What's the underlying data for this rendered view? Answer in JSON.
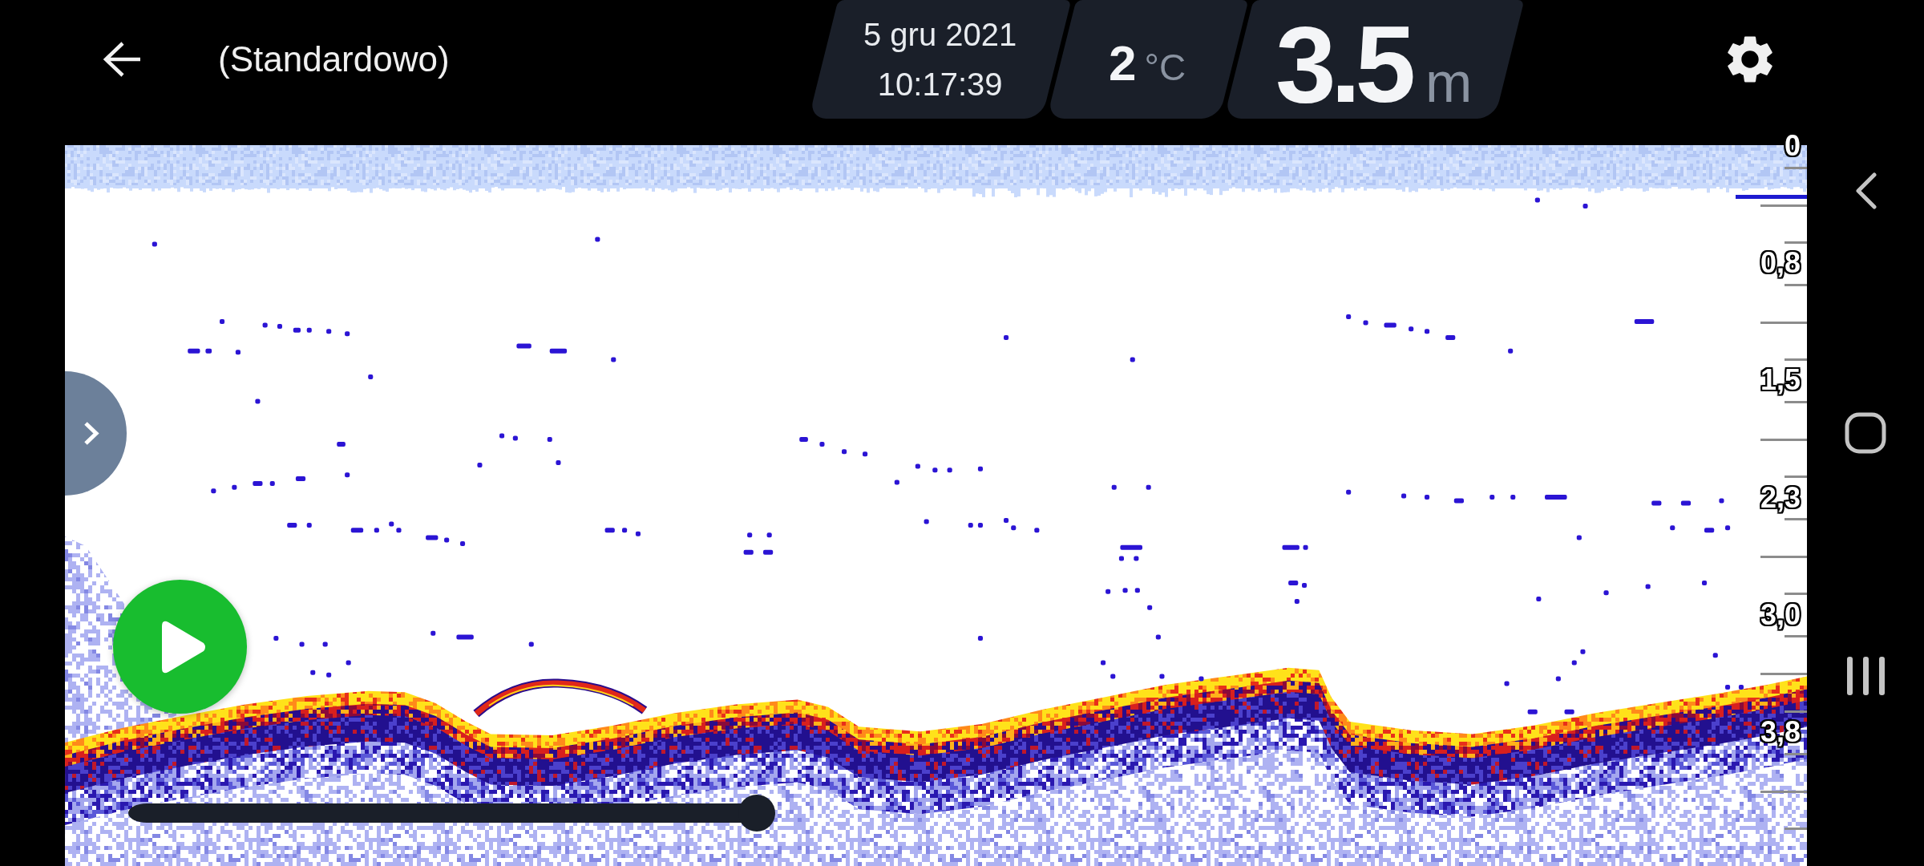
{
  "header": {
    "title": "(Standardowo)",
    "date": "5 gru 2021",
    "time": "10:17:39",
    "temperature": {
      "value": "2",
      "unit": "°C"
    },
    "depth": {
      "value": "3.5",
      "unit": "m"
    }
  },
  "depth_scale": {
    "labels": [
      "0",
      "0,8",
      "1,5",
      "2,3",
      "3,0",
      "3,8"
    ]
  },
  "playback": {
    "level": 1
  }
}
